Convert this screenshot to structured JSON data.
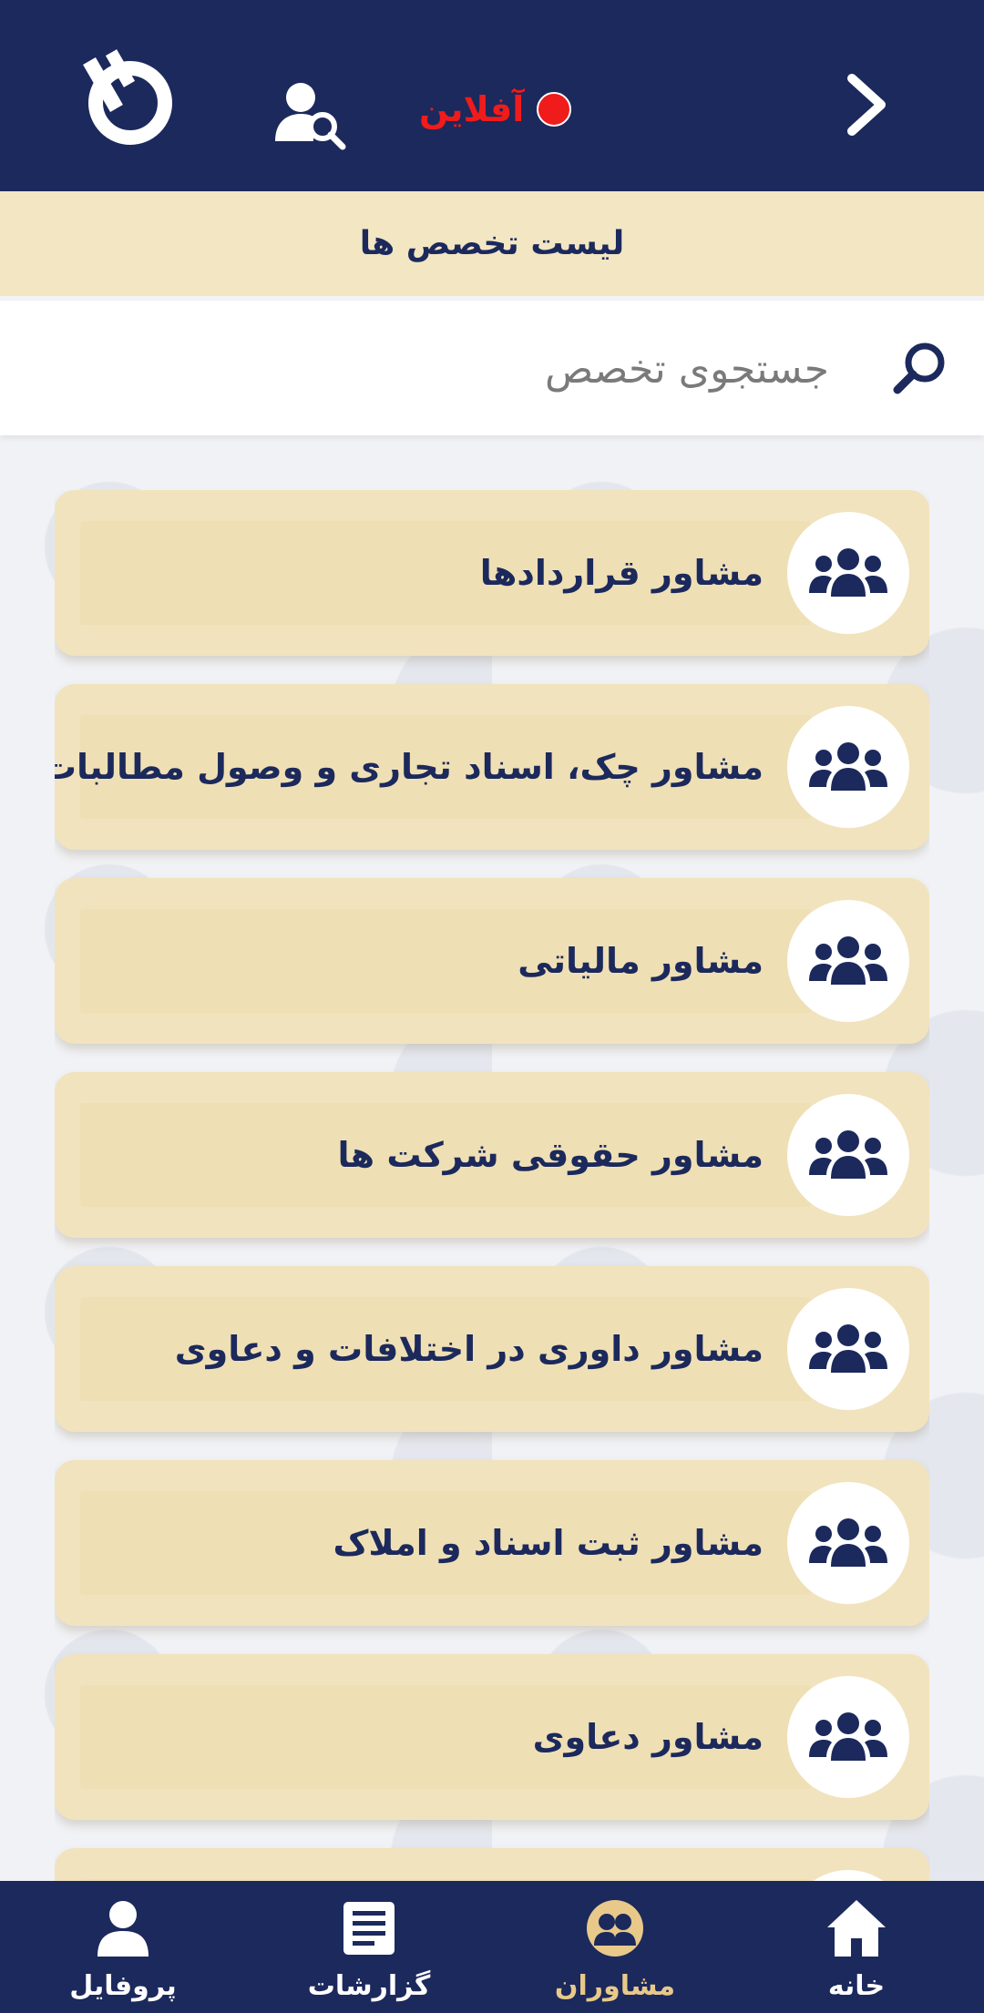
{
  "header": {
    "status_label": "آفلاین",
    "status_color": "#f01b1b",
    "back_icon": "chevron-right-icon",
    "user_search_icon": "user-search-icon",
    "logo_icon": "app-logo"
  },
  "page": {
    "title": "لیست تخصص ها"
  },
  "search": {
    "placeholder": "جستجوی تخصص",
    "value": ""
  },
  "specialties": [
    {
      "label": "مشاور قراردادها",
      "icon": "users-group-icon"
    },
    {
      "label": "مشاور چک، اسناد تجاری و وصول مطالبات",
      "icon": "users-group-icon"
    },
    {
      "label": "مشاور مالیاتی",
      "icon": "users-group-icon"
    },
    {
      "label": "مشاور حقوقی شرکت ها",
      "icon": "users-group-icon"
    },
    {
      "label": "مشاور  داوری در اختلافات و دعاوی",
      "icon": "users-group-icon"
    },
    {
      "label": "مشاور ثبت اسناد و املاک",
      "icon": "users-group-icon"
    },
    {
      "label": "مشاور دعاوی",
      "icon": "users-group-icon"
    },
    {
      "label": "",
      "icon": "users-group-icon"
    }
  ],
  "bottom_nav": [
    {
      "label": "خانه",
      "icon": "home-icon",
      "active": false
    },
    {
      "label": "مشاوران",
      "icon": "advisors-icon",
      "active": true
    },
    {
      "label": "گزارشات",
      "icon": "reports-icon",
      "active": false
    },
    {
      "label": "پروفایل",
      "icon": "profile-icon",
      "active": false
    }
  ],
  "colors": {
    "primary": "#1b295c",
    "card": "#f1e3bd",
    "accent": "#e8c98a"
  }
}
